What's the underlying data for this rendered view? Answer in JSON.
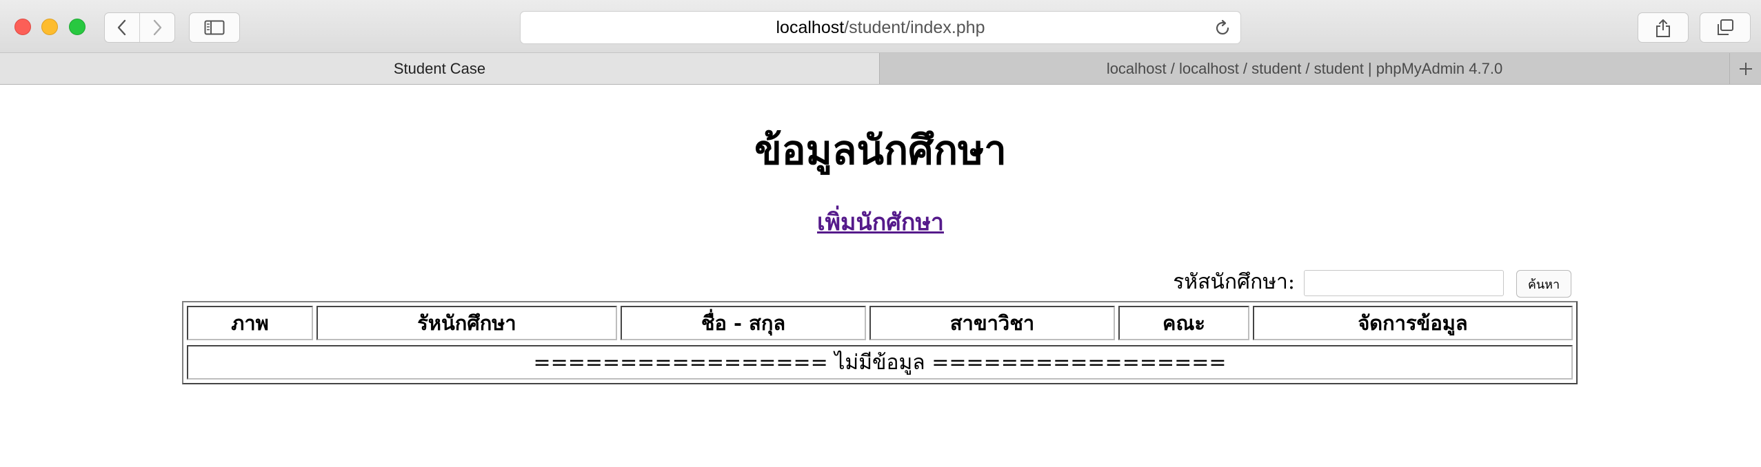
{
  "browser": {
    "url_host": "localhost",
    "url_path": "/student/index.php",
    "tabs": [
      {
        "label": "Student Case",
        "active": true
      },
      {
        "label": "localhost / localhost / student / student | phpMyAdmin 4.7.0",
        "active": false
      }
    ]
  },
  "page": {
    "title": "ข้อมูลนักศึกษา",
    "add_link": "เพิ่มนักศักษา",
    "search": {
      "label": "รหัสนักศึกษา:",
      "value": "",
      "button": "ค้นหา"
    },
    "table": {
      "headers": [
        "ภาพ",
        "รัหนักศึกษา",
        "ชื่อ - สกุล",
        "สาขาวิชา",
        "คณะ",
        "จัดการข้อมูล"
      ],
      "empty_message": "================= ไม่มีข้อมูล ================="
    }
  },
  "icons": {
    "back": "chevron-left-icon",
    "forward": "chevron-right-icon",
    "sidebar": "sidebar-icon",
    "reload": "reload-icon",
    "share": "share-icon",
    "tabs_overview": "tabs-overview-icon",
    "new_tab": "plus-icon"
  }
}
